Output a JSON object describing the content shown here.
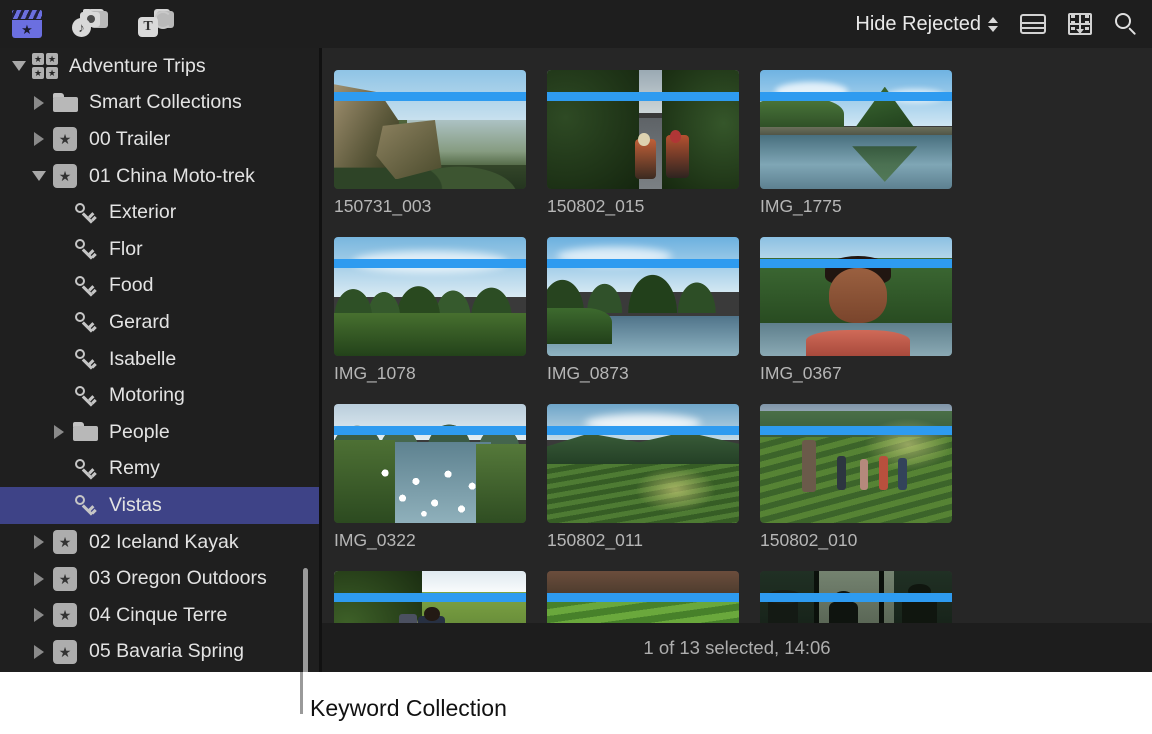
{
  "toolbar": {
    "library_icon": "clapperboard-star-icon",
    "photos_audio_icon": "photos-audio-icon",
    "titles_generators_icon": "titles-generators-icon",
    "filter_label": "Hide Rejected",
    "list_view_icon": "list-view-icon",
    "filmstrip_view_icon": "filmstrip-view-icon",
    "search_icon": "search-icon"
  },
  "sidebar": {
    "items": [
      {
        "label": "Adventure Trips",
        "icon": "library",
        "indent": 0,
        "disclosure": "down",
        "selected": false
      },
      {
        "label": "Smart Collections",
        "icon": "folder",
        "indent": 1,
        "disclosure": "right",
        "selected": false
      },
      {
        "label": "00 Trailer",
        "icon": "event",
        "indent": 1,
        "disclosure": "right",
        "selected": false
      },
      {
        "label": "01 China Moto-trek",
        "icon": "event",
        "indent": 1,
        "disclosure": "down",
        "selected": false
      },
      {
        "label": "Exterior",
        "icon": "keyword",
        "indent": 2,
        "disclosure": "none",
        "selected": false
      },
      {
        "label": "Flor",
        "icon": "keyword",
        "indent": 2,
        "disclosure": "none",
        "selected": false
      },
      {
        "label": "Food",
        "icon": "keyword",
        "indent": 2,
        "disclosure": "none",
        "selected": false
      },
      {
        "label": "Gerard",
        "icon": "keyword",
        "indent": 2,
        "disclosure": "none",
        "selected": false
      },
      {
        "label": "Isabelle",
        "icon": "keyword",
        "indent": 2,
        "disclosure": "none",
        "selected": false
      },
      {
        "label": "Motoring",
        "icon": "keyword",
        "indent": 2,
        "disclosure": "none",
        "selected": false
      },
      {
        "label": "People",
        "icon": "folder",
        "indent": 2,
        "disclosure": "right",
        "selected": false
      },
      {
        "label": "Remy",
        "icon": "keyword",
        "indent": 2,
        "disclosure": "none",
        "selected": false
      },
      {
        "label": "Vistas",
        "icon": "keyword",
        "indent": 2,
        "disclosure": "none",
        "selected": true
      },
      {
        "label": "02 Iceland Kayak",
        "icon": "event",
        "indent": 1,
        "disclosure": "right",
        "selected": false
      },
      {
        "label": "03 Oregon Outdoors",
        "icon": "event",
        "indent": 1,
        "disclosure": "right",
        "selected": false
      },
      {
        "label": "04 Cinque Terre",
        "icon": "event",
        "indent": 1,
        "disclosure": "right",
        "selected": false
      },
      {
        "label": "05 Bavaria Spring",
        "icon": "event",
        "indent": 1,
        "disclosure": "right",
        "selected": false
      }
    ],
    "selection_color": "#3e4387"
  },
  "browser": {
    "keyword_bar_color": "#2e9bf0",
    "clips": [
      {
        "name": "150731_003",
        "art": "art-a"
      },
      {
        "name": "150802_015",
        "art": "art-b"
      },
      {
        "name": "IMG_1775",
        "art": "art-c"
      },
      {
        "name": "IMG_1078",
        "art": "art-d"
      },
      {
        "name": "IMG_0873",
        "art": "art-e"
      },
      {
        "name": "IMG_0367",
        "art": "art-f"
      },
      {
        "name": "IMG_0322",
        "art": "art-g"
      },
      {
        "name": "150802_011",
        "art": "art-h"
      },
      {
        "name": "150802_010",
        "art": "art-i"
      },
      {
        "name": "",
        "art": "art-j"
      },
      {
        "name": "",
        "art": "art-k"
      },
      {
        "name": "",
        "art": "art-l"
      }
    ]
  },
  "status": {
    "text": "1 of 13 selected, 14:06"
  },
  "callout": {
    "label": "Keyword Collection"
  }
}
